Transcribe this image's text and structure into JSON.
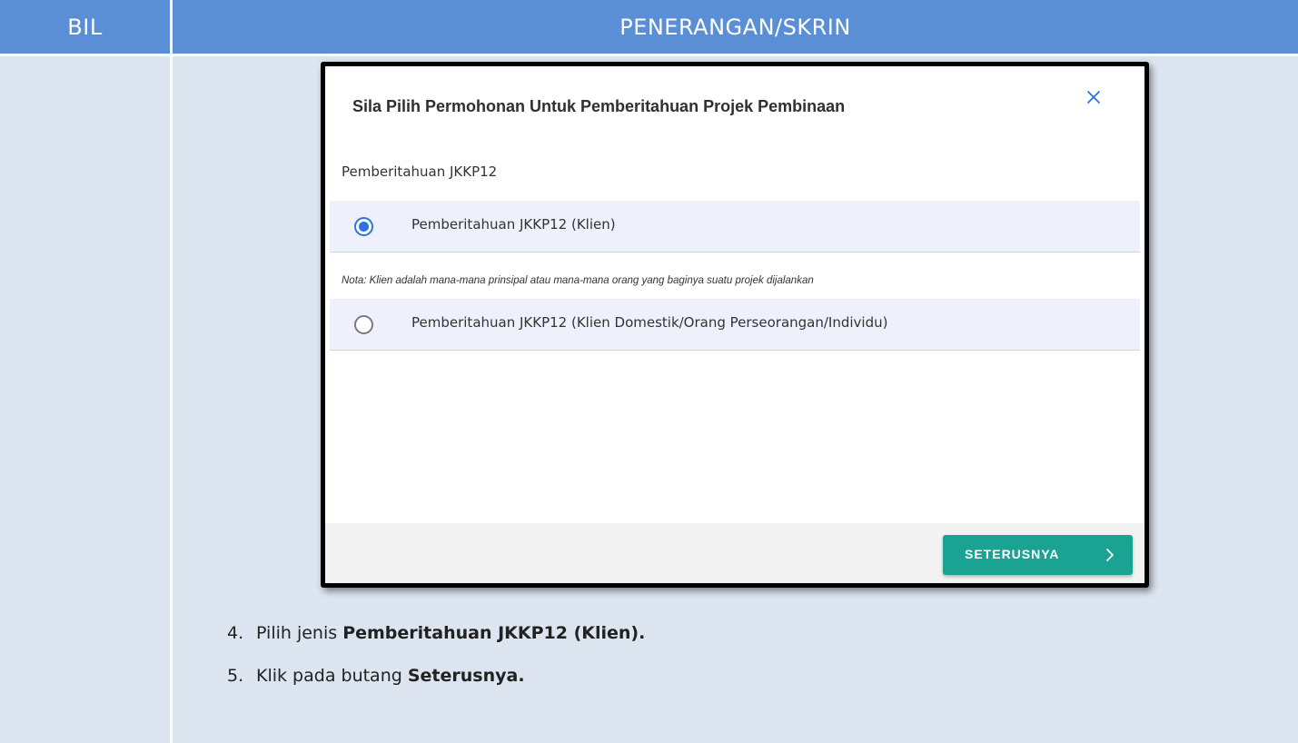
{
  "table": {
    "headers": {
      "bil": "BIL",
      "penerangan": "PENERANGAN/SKRIN"
    }
  },
  "modal": {
    "title": "Sila Pilih Permohonan Untuk Pemberitahuan Projek Pembinaan",
    "close_icon": "close-icon",
    "section_label": "Pemberitahuan JKKP12",
    "options": [
      {
        "label": "Pemberitahuan JKKP12 (Klien)",
        "selected": true
      },
      {
        "label": "Pemberitahuan JKKP12 (Klien Domestik/Orang Perseorangan/Individu)",
        "selected": false
      }
    ],
    "note": "Nota: Klien adalah mana-mana prinsipal atau mana-mana orang yang baginya suatu projek dijalankan",
    "next_button": {
      "label": "SETERUSNYA",
      "icon": "chevron-right-icon"
    }
  },
  "colors": {
    "header_bg": "#5b8fd5",
    "body_bg": "#dde5f0",
    "radio_accent": "#2b74e3",
    "button_bg": "#1aa392"
  },
  "steps": [
    {
      "number": "4.",
      "text": "Pilih jenis ",
      "bold": "Pemberitahuan JKKP12 (Klien)."
    },
    {
      "number": "5.",
      "text": "Klik pada butang ",
      "bold": "Seterusnya."
    }
  ]
}
